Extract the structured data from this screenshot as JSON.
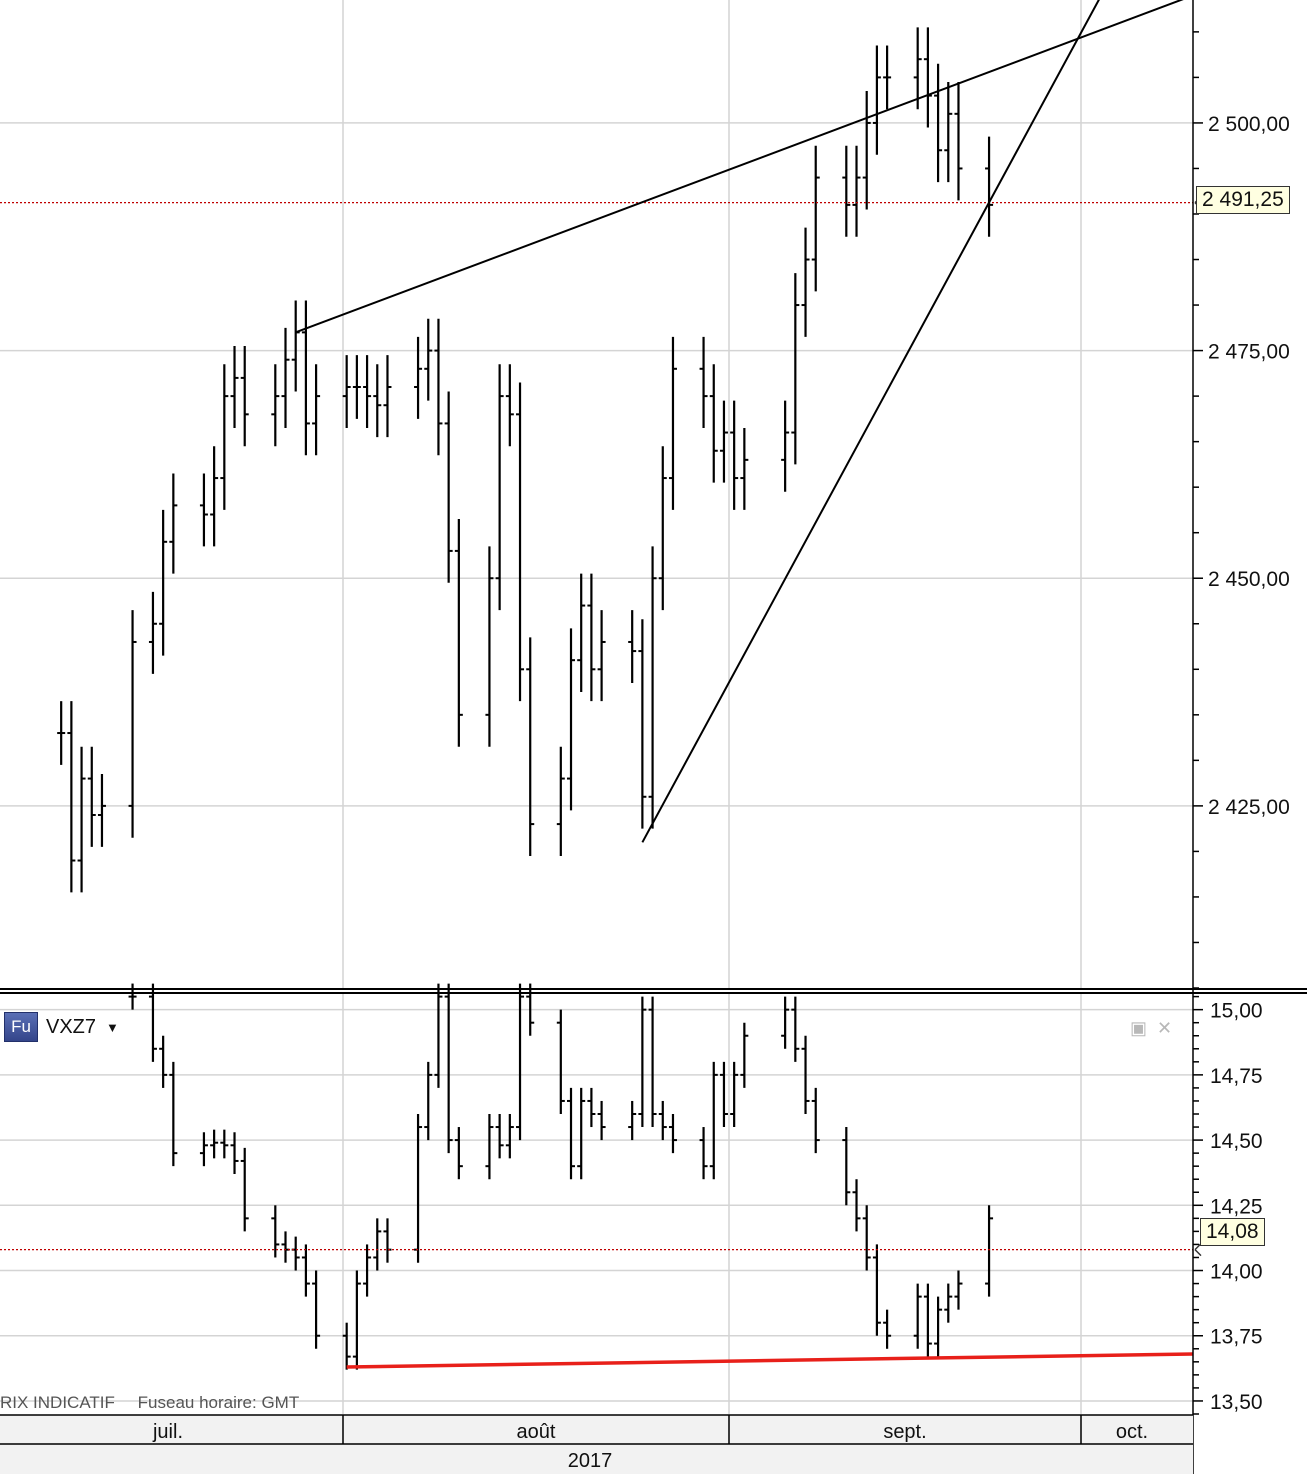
{
  "chart_data": [
    {
      "type": "bar",
      "instrument": "",
      "price_axis": {
        "ticks": [
          "2 500,00",
          "2 475,00",
          "2 450,00",
          "2 425,00"
        ],
        "tick_values": [
          2500,
          2475,
          2450,
          2425
        ],
        "range": [
          2405,
          2513.5
        ]
      },
      "current_price": {
        "label": "2 491,25",
        "value": 2491.25,
        "color": "#c00000"
      },
      "series": [
        {
          "name": "",
          "points": [
            {
              "x": "2017-06-26",
              "y": 2433
            },
            {
              "x": "2017-06-27",
              "y": 2419
            },
            {
              "x": "2017-06-28",
              "y": 2428
            },
            {
              "x": "2017-06-29",
              "y": 2424
            },
            {
              "x": "2017-06-30",
              "y": 2425
            },
            {
              "x": "2017-07-03",
              "y": 2443
            },
            {
              "x": "2017-07-05",
              "y": 2445
            },
            {
              "x": "2017-07-06",
              "y": 2454
            },
            {
              "x": "2017-07-07",
              "y": 2458
            },
            {
              "x": "2017-07-10",
              "y": 2457
            },
            {
              "x": "2017-07-11",
              "y": 2461
            },
            {
              "x": "2017-07-12",
              "y": 2470
            },
            {
              "x": "2017-07-13",
              "y": 2472
            },
            {
              "x": "2017-07-14",
              "y": 2468
            },
            {
              "x": "2017-07-17",
              "y": 2470
            },
            {
              "x": "2017-07-18",
              "y": 2474
            },
            {
              "x": "2017-07-19",
              "y": 2477
            },
            {
              "x": "2017-07-20",
              "y": 2467
            },
            {
              "x": "2017-07-21",
              "y": 2470
            },
            {
              "x": "2017-07-24",
              "y": 2471
            },
            {
              "x": "2017-07-25",
              "y": 2471
            },
            {
              "x": "2017-07-26",
              "y": 2470
            },
            {
              "x": "2017-07-27",
              "y": 2469
            },
            {
              "x": "2017-07-28",
              "y": 2471
            },
            {
              "x": "2017-07-31",
              "y": 2473
            },
            {
              "x": "2017-08-01",
              "y": 2475
            },
            {
              "x": "2017-08-02",
              "y": 2467
            },
            {
              "x": "2017-08-03",
              "y": 2453
            },
            {
              "x": "2017-08-04",
              "y": 2435
            },
            {
              "x": "2017-08-07",
              "y": 2450
            },
            {
              "x": "2017-08-08",
              "y": 2470
            },
            {
              "x": "2017-08-09",
              "y": 2468
            },
            {
              "x": "2017-08-10",
              "y": 2440
            },
            {
              "x": "2017-08-11",
              "y": 2423
            },
            {
              "x": "2017-08-14",
              "y": 2428
            },
            {
              "x": "2017-08-15",
              "y": 2441
            },
            {
              "x": "2017-08-16",
              "y": 2447
            },
            {
              "x": "2017-08-17",
              "y": 2440
            },
            {
              "x": "2017-08-18",
              "y": 2443
            },
            {
              "x": "2017-08-21",
              "y": 2442
            },
            {
              "x": "2017-08-22",
              "y": 2426
            },
            {
              "x": "2017-08-23",
              "y": 2450
            },
            {
              "x": "2017-08-24",
              "y": 2461
            },
            {
              "x": "2017-08-25",
              "y": 2473
            },
            {
              "x": "2017-08-28",
              "y": 2470
            },
            {
              "x": "2017-08-29",
              "y": 2464
            },
            {
              "x": "2017-08-30",
              "y": 2466
            },
            {
              "x": "2017-08-31",
              "y": 2461
            },
            {
              "x": "2017-09-01",
              "y": 2463
            },
            {
              "x": "2017-09-05",
              "y": 2466
            },
            {
              "x": "2017-09-06",
              "y": 2480
            },
            {
              "x": "2017-09-07",
              "y": 2485
            },
            {
              "x": "2017-09-08",
              "y": 2494
            },
            {
              "x": "2017-09-11",
              "y": 2491
            },
            {
              "x": "2017-09-12",
              "y": 2494
            },
            {
              "x": "2017-09-13",
              "y": 2500
            },
            {
              "x": "2017-09-14",
              "y": 2505
            },
            {
              "x": "2017-09-15",
              "y": 2505
            },
            {
              "x": "2017-09-18",
              "y": 2507
            },
            {
              "x": "2017-09-19",
              "y": 2503
            },
            {
              "x": "2017-09-20",
              "y": 2497
            },
            {
              "x": "2017-09-21",
              "y": 2501
            },
            {
              "x": "2017-09-22",
              "y": 2495
            },
            {
              "x": "2017-09-25",
              "y": 2491
            }
          ]
        }
      ],
      "trendlines": [
        {
          "from": {
            "x": "2017-07-19",
            "y": 2477
          },
          "to": {
            "x": "2017-10-15",
            "y": 2514
          },
          "color": "#000000"
        },
        {
          "from": {
            "x": "2017-08-22",
            "y": 2421
          },
          "to": {
            "x": "2017-10-06",
            "y": 2514
          },
          "color": "#000000"
        }
      ],
      "x_axis": {
        "months": [
          "juil.",
          "août",
          "sept.",
          "oct."
        ],
        "year": "2017",
        "range": [
          "2017-06-20",
          "2017-10-15"
        ]
      },
      "grid": true
    },
    {
      "type": "bar",
      "instrument": "VXZ7",
      "instrument_badge": "Fu",
      "price_axis": {
        "ticks": [
          "15,00",
          "14,75",
          "14,50",
          "14,25",
          "14,00",
          "13,75",
          "13,50"
        ],
        "tick_values": [
          15.0,
          14.75,
          14.5,
          14.25,
          14.0,
          13.75,
          13.5
        ],
        "range": [
          13.45,
          15.06
        ]
      },
      "current_price": {
        "label": "14,08",
        "value": 14.08,
        "color": "#c00000"
      },
      "series": [
        {
          "name": "",
          "points": [
            {
              "x": "2017-07-03",
              "y": 15.05
            },
            {
              "x": "2017-07-05",
              "y": 14.85
            },
            {
              "x": "2017-07-06",
              "y": 14.75
            },
            {
              "x": "2017-07-07",
              "y": 14.45
            },
            {
              "x": "2017-07-10",
              "y": 14.48
            },
            {
              "x": "2017-07-11",
              "y": 14.49
            },
            {
              "x": "2017-07-12",
              "y": 14.48
            },
            {
              "x": "2017-07-13",
              "y": 14.42
            },
            {
              "x": "2017-07-14",
              "y": 14.2
            },
            {
              "x": "2017-07-17",
              "y": 14.1
            },
            {
              "x": "2017-07-18",
              "y": 14.08
            },
            {
              "x": "2017-07-19",
              "y": 14.05
            },
            {
              "x": "2017-07-20",
              "y": 13.95
            },
            {
              "x": "2017-07-21",
              "y": 13.75
            },
            {
              "x": "2017-07-24",
              "y": 13.67
            },
            {
              "x": "2017-07-25",
              "y": 13.95
            },
            {
              "x": "2017-07-26",
              "y": 14.05
            },
            {
              "x": "2017-07-27",
              "y": 14.15
            },
            {
              "x": "2017-07-28",
              "y": 14.08
            },
            {
              "x": "2017-07-31",
              "y": 14.55
            },
            {
              "x": "2017-08-01",
              "y": 14.75
            },
            {
              "x": "2017-08-02",
              "y": 15.05
            },
            {
              "x": "2017-08-03",
              "y": 14.5
            },
            {
              "x": "2017-08-04",
              "y": 14.4
            },
            {
              "x": "2017-08-07",
              "y": 14.55
            },
            {
              "x": "2017-08-08",
              "y": 14.48
            },
            {
              "x": "2017-08-09",
              "y": 14.55
            },
            {
              "x": "2017-08-10",
              "y": 15.05
            },
            {
              "x": "2017-08-11",
              "y": 14.95
            },
            {
              "x": "2017-08-14",
              "y": 14.65
            },
            {
              "x": "2017-08-15",
              "y": 14.4
            },
            {
              "x": "2017-08-16",
              "y": 14.65
            },
            {
              "x": "2017-08-17",
              "y": 14.6
            },
            {
              "x": "2017-08-18",
              "y": 14.55
            },
            {
              "x": "2017-08-21",
              "y": 14.6
            },
            {
              "x": "2017-08-22",
              "y": 15.0
            },
            {
              "x": "2017-08-23",
              "y": 14.6
            },
            {
              "x": "2017-08-24",
              "y": 14.55
            },
            {
              "x": "2017-08-25",
              "y": 14.5
            },
            {
              "x": "2017-08-28",
              "y": 14.4
            },
            {
              "x": "2017-08-29",
              "y": 14.75
            },
            {
              "x": "2017-08-30",
              "y": 14.6
            },
            {
              "x": "2017-08-31",
              "y": 14.75
            },
            {
              "x": "2017-09-01",
              "y": 14.9
            },
            {
              "x": "2017-09-05",
              "y": 15.0
            },
            {
              "x": "2017-09-06",
              "y": 14.85
            },
            {
              "x": "2017-09-07",
              "y": 14.65
            },
            {
              "x": "2017-09-08",
              "y": 14.5
            },
            {
              "x": "2017-09-11",
              "y": 14.3
            },
            {
              "x": "2017-09-12",
              "y": 14.2
            },
            {
              "x": "2017-09-13",
              "y": 14.05
            },
            {
              "x": "2017-09-14",
              "y": 13.8
            },
            {
              "x": "2017-09-15",
              "y": 13.75
            },
            {
              "x": "2017-09-18",
              "y": 13.9
            },
            {
              "x": "2017-09-19",
              "y": 13.72
            },
            {
              "x": "2017-09-20",
              "y": 13.85
            },
            {
              "x": "2017-09-21",
              "y": 13.9
            },
            {
              "x": "2017-09-22",
              "y": 13.95
            },
            {
              "x": "2017-09-25",
              "y": 14.2
            }
          ]
        }
      ],
      "trendlines": [
        {
          "from": {
            "x": "2017-07-24",
            "y": 13.63
          },
          "to": {
            "x": "2017-10-15",
            "y": 13.68
          },
          "color": "#e8201a"
        }
      ],
      "grid": true
    }
  ],
  "footer": {
    "note": "RIX INDICATIF",
    "timezone": "Fuseau horaire: GMT"
  },
  "pane_controls": {
    "restore_icon": "restore-icon",
    "close_icon": "close-icon"
  }
}
